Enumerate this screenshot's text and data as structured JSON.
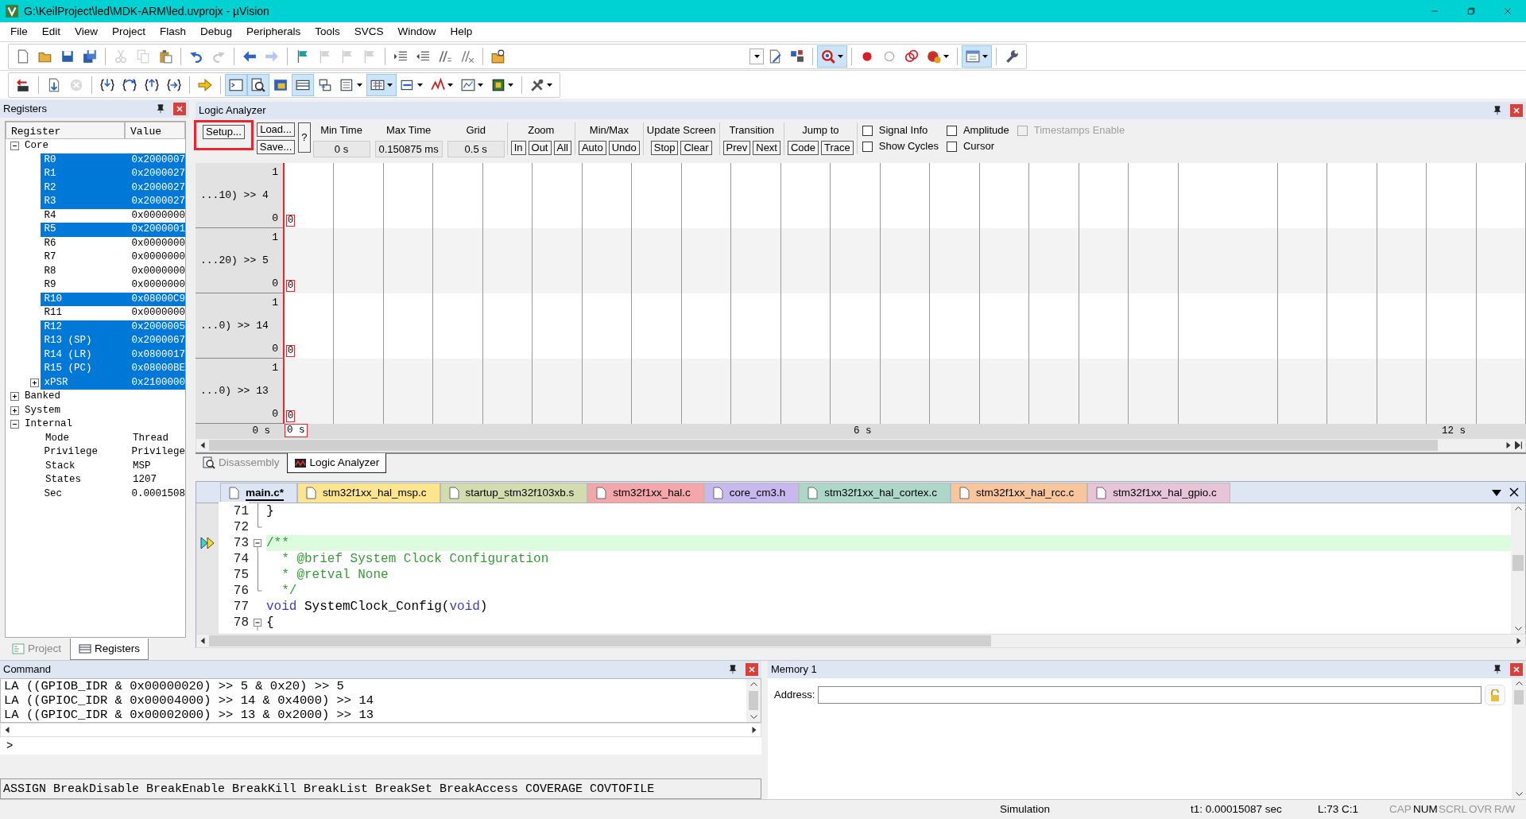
{
  "window": {
    "title": "G:\\KeilProject\\led\\MDK-ARM\\led.uvprojx - µVision"
  },
  "menu": [
    "File",
    "Edit",
    "View",
    "Project",
    "Flash",
    "Debug",
    "Peripherals",
    "Tools",
    "SVCS",
    "Window",
    "Help"
  ],
  "toolbars": [
    [
      [
        {
          "kind": "new",
          "on": false,
          "menu": false,
          "disabled": false
        },
        {
          "kind": "open",
          "on": false,
          "menu": false,
          "disabled": false
        },
        {
          "kind": "save",
          "on": false,
          "menu": false,
          "disabled": false
        },
        {
          "kind": "save_all",
          "on": false,
          "menu": false,
          "disabled": false
        }
      ],
      [
        {
          "kind": "cut",
          "on": false,
          "menu": false,
          "disabled": true
        },
        {
          "kind": "copy",
          "on": false,
          "menu": false,
          "disabled": true
        },
        {
          "kind": "paste",
          "on": false,
          "menu": false,
          "disabled": false
        }
      ],
      [
        {
          "kind": "undo",
          "on": false,
          "menu": false,
          "disabled": false
        },
        {
          "kind": "redo",
          "on": false,
          "menu": false,
          "disabled": true
        }
      ],
      [
        {
          "kind": "back",
          "on": false,
          "menu": false,
          "disabled": false
        },
        {
          "kind": "forward",
          "on": false,
          "menu": false,
          "disabled": true
        }
      ],
      [
        {
          "kind": "bookmark",
          "on": false,
          "menu": false,
          "disabled": false
        },
        {
          "kind": "bookmark_prev",
          "on": false,
          "menu": false,
          "disabled": true
        },
        {
          "kind": "bookmark_next",
          "on": false,
          "menu": false,
          "disabled": true
        },
        {
          "kind": "bookmark_clear",
          "on": false,
          "menu": false,
          "disabled": true
        }
      ],
      [
        {
          "kind": "indent",
          "on": false,
          "menu": false,
          "disabled": false
        },
        {
          "kind": "outdent",
          "on": false,
          "menu": false,
          "disabled": false
        },
        {
          "kind": "comment",
          "on": false,
          "menu": false,
          "disabled": false
        },
        {
          "kind": "uncomment",
          "on": false,
          "menu": false,
          "disabled": false
        }
      ],
      [
        {
          "kind": "find_files",
          "on": false,
          "menu": false,
          "disabled": false
        },
        {
          "kind": "combo",
          "on": false,
          "menu": true,
          "disabled": false
        },
        {
          "kind": "options",
          "on": false,
          "menu": false,
          "disabled": false
        },
        {
          "kind": "manage",
          "on": false,
          "menu": false,
          "disabled": false
        }
      ],
      [
        {
          "kind": "debug",
          "on": true,
          "menu": true,
          "disabled": false
        }
      ],
      [
        {
          "kind": "bp",
          "on": false,
          "menu": false,
          "disabled": false
        },
        {
          "kind": "bp_enable",
          "on": false,
          "menu": false,
          "disabled": false
        },
        {
          "kind": "bp_disable",
          "on": false,
          "menu": false,
          "disabled": false
        },
        {
          "kind": "bp_kill",
          "on": false,
          "menu": true,
          "disabled": false
        }
      ],
      [
        {
          "kind": "window",
          "on": true,
          "menu": true,
          "disabled": false
        }
      ],
      [
        {
          "kind": "wrench",
          "on": false,
          "menu": false,
          "disabled": false
        }
      ]
    ],
    [
      [
        {
          "kind": "reset",
          "on": false,
          "menu": false,
          "disabled": false
        }
      ],
      [
        {
          "kind": "run",
          "on": false,
          "menu": false,
          "disabled": false
        },
        {
          "kind": "stop",
          "on": false,
          "menu": false,
          "disabled": true
        }
      ],
      [
        {
          "kind": "step",
          "on": false,
          "menu": false,
          "disabled": false
        },
        {
          "kind": "step_over",
          "on": false,
          "menu": false,
          "disabled": false
        },
        {
          "kind": "step_out",
          "on": false,
          "menu": false,
          "disabled": false
        },
        {
          "kind": "run_cursor",
          "on": false,
          "menu": false,
          "disabled": false
        }
      ],
      [
        {
          "kind": "next_statement",
          "on": false,
          "menu": false,
          "disabled": false
        }
      ],
      [
        {
          "kind": "cmd",
          "on": true,
          "menu": false,
          "disabled": false
        },
        {
          "kind": "disasm",
          "on": true,
          "menu": false,
          "disabled": false
        },
        {
          "kind": "symbols",
          "on": false,
          "menu": false,
          "disabled": false
        },
        {
          "kind": "registers",
          "on": true,
          "menu": false,
          "disabled": false
        },
        {
          "kind": "callstack",
          "on": false,
          "menu": false,
          "disabled": false
        },
        {
          "kind": "watch",
          "on": false,
          "menu": true,
          "disabled": false
        },
        {
          "kind": "memory",
          "on": true,
          "menu": true,
          "disabled": false
        },
        {
          "kind": "serial",
          "on": false,
          "menu": true,
          "disabled": false
        },
        {
          "kind": "analysis",
          "on": false,
          "menu": true,
          "disabled": false
        },
        {
          "kind": "trace",
          "on": false,
          "menu": true,
          "disabled": false
        },
        {
          "kind": "sysview",
          "on": false,
          "menu": true,
          "disabled": false
        }
      ],
      [
        {
          "kind": "toolbox",
          "on": false,
          "menu": true,
          "disabled": false
        }
      ]
    ]
  ],
  "registers": {
    "title": "Registers",
    "columns": [
      "Register",
      "Value"
    ],
    "tree": [
      {
        "name": "Core",
        "expanded": true,
        "selected": false,
        "children": [
          {
            "name": "R0",
            "value": "0x2000007",
            "selected": true
          },
          {
            "name": "R1",
            "value": "0x2000027",
            "selected": true
          },
          {
            "name": "R2",
            "value": "0x2000027",
            "selected": true
          },
          {
            "name": "R3",
            "value": "0x2000027",
            "selected": true
          },
          {
            "name": "R4",
            "value": "0x0000000",
            "selected": false
          },
          {
            "name": "R5",
            "value": "0x2000001",
            "selected": true
          },
          {
            "name": "R6",
            "value": "0x0000000",
            "selected": false
          },
          {
            "name": "R7",
            "value": "0x0000000",
            "selected": false
          },
          {
            "name": "R8",
            "value": "0x0000000",
            "selected": false
          },
          {
            "name": "R9",
            "value": "0x0000000",
            "selected": false
          },
          {
            "name": "R10",
            "value": "0x08000C9",
            "selected": true
          },
          {
            "name": "R11",
            "value": "0x0000000",
            "selected": false
          },
          {
            "name": "R12",
            "value": "0x2000005",
            "selected": true
          },
          {
            "name": "R13 (SP)",
            "value": "0x2000067",
            "selected": true
          },
          {
            "name": "R14 (LR)",
            "value": "0x0800017",
            "selected": true
          },
          {
            "name": "R15 (PC)",
            "value": "0x08000BE",
            "selected": true
          },
          {
            "name": "xPSR",
            "value": "0x2100000",
            "selected": true,
            "expanded": false
          }
        ]
      },
      {
        "name": "Banked",
        "expanded": false,
        "selected": false
      },
      {
        "name": "System",
        "expanded": false,
        "selected": false
      },
      {
        "name": "Internal",
        "expanded": true,
        "selected": false,
        "children": [
          {
            "name": "Mode",
            "value": "Thread",
            "selected": false
          },
          {
            "name": "Privilege",
            "value": "Privilege",
            "selected": false
          },
          {
            "name": "Stack",
            "value": "MSP",
            "selected": false
          },
          {
            "name": "States",
            "value": "1207",
            "selected": false
          },
          {
            "name": "Sec",
            "value": "0.0001508",
            "selected": false
          }
        ]
      }
    ],
    "tabs": [
      {
        "label": "Project",
        "selected": false
      },
      {
        "label": "Registers",
        "selected": true
      }
    ]
  },
  "logic_analyzer": {
    "title": "Logic Analyzer",
    "file_buttons": [
      {
        "label": "Setup...",
        "highlighted": true
      },
      {
        "label": "Load...",
        "highlighted": false
      },
      {
        "label": "Save...",
        "highlighted": false
      },
      {
        "label": "?",
        "highlighted": false
      }
    ],
    "fields": [
      {
        "label": "Min Time",
        "value": "0 s"
      },
      {
        "label": "Max Time",
        "value": "0.150875 ms"
      },
      {
        "label": "Grid",
        "value": "0.5 s"
      }
    ],
    "button_groups": [
      {
        "label": "Zoom",
        "buttons": [
          "In",
          "Out",
          "All"
        ]
      },
      {
        "label": "Min/Max",
        "buttons": [
          "Auto",
          "Undo"
        ]
      },
      {
        "label": "Update Screen",
        "buttons": [
          "Stop",
          "Clear"
        ]
      },
      {
        "label": "Transition",
        "buttons": [
          "Prev",
          "Next"
        ]
      },
      {
        "label": "Jump to",
        "buttons": [
          "Code",
          "Trace"
        ]
      }
    ],
    "options": [
      {
        "label": "Signal Info",
        "checked": false,
        "disabled": false
      },
      {
        "label": "Show Cycles",
        "checked": false,
        "disabled": false
      },
      {
        "label": "Amplitude",
        "checked": false,
        "disabled": false
      },
      {
        "label": "Cursor",
        "checked": false,
        "disabled": false
      },
      {
        "label": "Timestamps Enable",
        "checked": false,
        "disabled": true
      }
    ],
    "signals": [
      {
        "name": "...10) >> 4",
        "high": "1",
        "low": "0",
        "value": "0"
      },
      {
        "name": "...20) >> 5",
        "high": "1",
        "low": "0",
        "value": "0"
      },
      {
        "name": "...0) >> 14",
        "high": "1",
        "low": "0",
        "value": "0"
      },
      {
        "name": "...0) >> 13",
        "high": "1",
        "low": "0",
        "value": "0"
      }
    ],
    "axis": {
      "origin": "0 s",
      "cursor": "0 s",
      "ticks": [
        "6 s",
        "12 s"
      ]
    }
  },
  "view_tabs": [
    {
      "label": "Disassembly",
      "selected": false
    },
    {
      "label": "Logic Analyzer",
      "selected": true
    }
  ],
  "editor": {
    "tabs": [
      {
        "label": "main.c*",
        "selected": true,
        "color": "#dbe5f3"
      },
      {
        "label": "stm32f1xx_hal_msp.c",
        "selected": false,
        "color": "#fde58f"
      },
      {
        "label": "startup_stm32f103xb.s",
        "selected": false,
        "color": "#d3dcae"
      },
      {
        "label": "stm32f1xx_hal.c",
        "selected": false,
        "color": "#f3a7aa"
      },
      {
        "label": "core_cm3.h",
        "selected": false,
        "color": "#c7b9ee"
      },
      {
        "label": "stm32f1xx_hal_cortex.c",
        "selected": false,
        "color": "#acd7c9"
      },
      {
        "label": "stm32f1xx_hal_rcc.c",
        "selected": false,
        "color": "#f9c59c"
      },
      {
        "label": "stm32f1xx_hal_gpio.c",
        "selected": false,
        "color": "#e8c4d9"
      }
    ],
    "lines": [
      {
        "number": "71",
        "kind": "mid",
        "current": false,
        "code": [
          {
            "kind": "text",
            "text": "}"
          }
        ]
      },
      {
        "number": "72",
        "kind": "end",
        "current": false
      },
      {
        "number": "73",
        "kind": "start",
        "current": true,
        "code": [
          {
            "kind": "comment",
            "text": "/**"
          }
        ]
      },
      {
        "number": "74",
        "kind": "mid",
        "current": false,
        "code": [
          {
            "kind": "comment",
            "text": "  * @brief System Clock Configuration"
          }
        ]
      },
      {
        "number": "75",
        "kind": "mid",
        "current": false,
        "code": [
          {
            "kind": "comment",
            "text": "  * @retval None"
          }
        ]
      },
      {
        "number": "76",
        "kind": "end",
        "current": false,
        "code": [
          {
            "kind": "comment",
            "text": "  */"
          }
        ]
      },
      {
        "number": "77",
        "kind": "plain",
        "current": false,
        "code": [
          {
            "kind": "keyword",
            "text": "void"
          },
          {
            "kind": "text",
            "text": " SystemClock_Config("
          },
          {
            "kind": "keyword",
            "text": "void"
          },
          {
            "kind": "text",
            "text": ")"
          }
        ]
      },
      {
        "number": "78",
        "kind": "start",
        "current": false,
        "code": [
          {
            "kind": "text",
            "text": "{"
          }
        ]
      }
    ]
  },
  "command": {
    "title": "Command",
    "output": [
      "LA ((GPIOB_IDR & 0x00000020) >> 5 & 0x20) >> 5",
      "LA ((GPIOC_IDR & 0x00004000) >> 14 & 0x4000) >> 14",
      "LA ((GPIOC_IDR & 0x00002000) >> 13 & 0x2000) >> 13"
    ],
    "prompt": ">",
    "hint": "ASSIGN BreakDisable BreakEnable BreakKill BreakList BreakSet BreakAccess COVERAGE COVTOFILE"
  },
  "memory": {
    "title": "Memory 1",
    "address_label": "Address:"
  },
  "status_bar": [
    {
      "text": "Simulation",
      "on": true
    },
    {
      "text": "t1: 0.00015087 sec",
      "on": true
    },
    {
      "text": "L:73 C:1",
      "on": true
    },
    {
      "text": "CAP",
      "on": false
    },
    {
      "text": "NUM",
      "on": true
    },
    {
      "text": "SCRL",
      "on": false
    },
    {
      "text": "OVR",
      "on": false
    },
    {
      "text": "R/W",
      "on": false
    }
  ]
}
